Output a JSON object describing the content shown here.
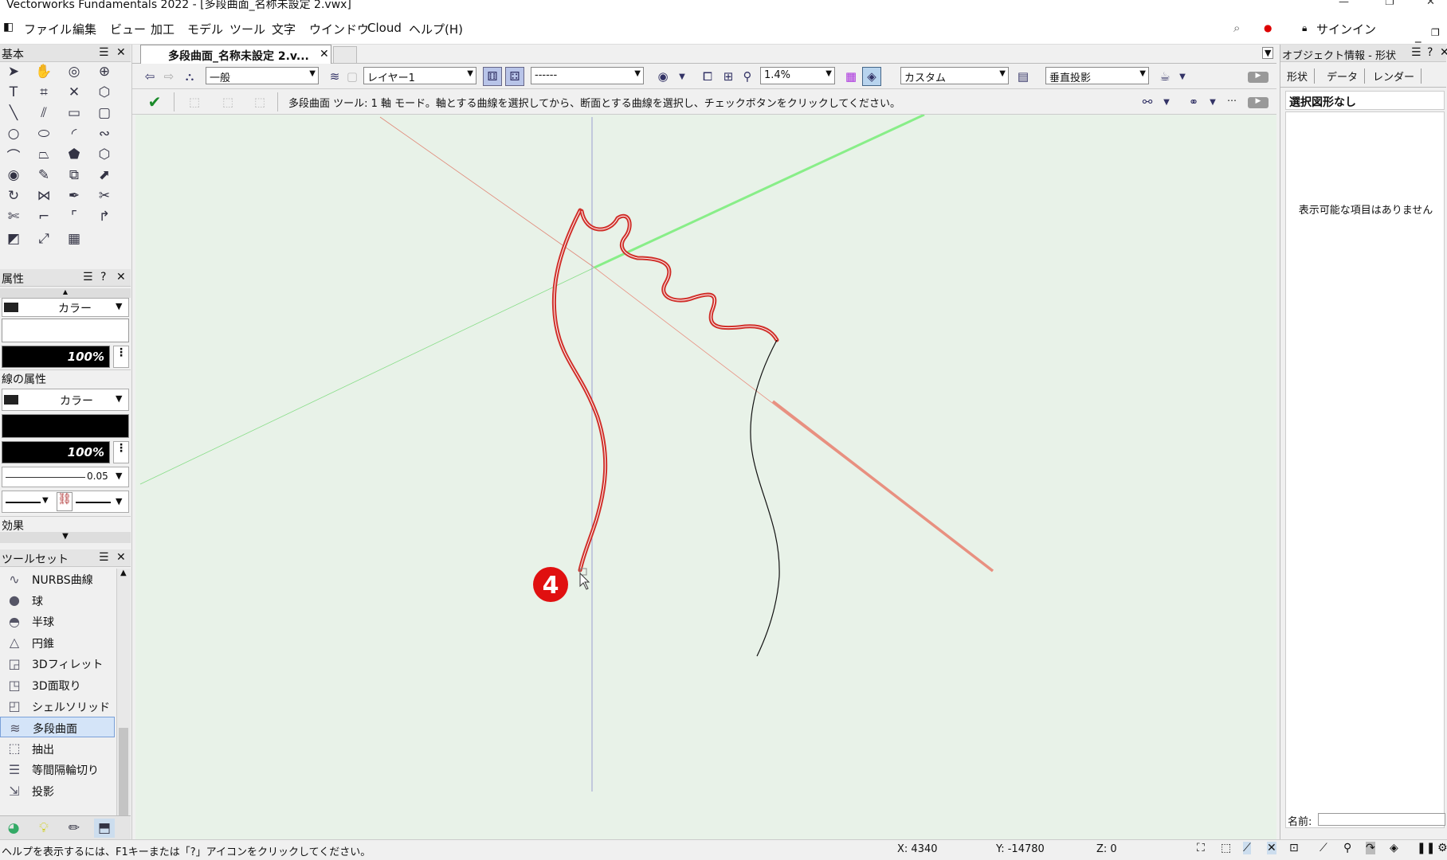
{
  "window": {
    "title": "Vectorworks Fundamentals 2022 - [多段曲面_名称未設定 2.vwx]"
  },
  "menu": [
    "ファイル",
    "編集",
    "ビュー",
    "加工",
    "モデル",
    "ツール",
    "文字",
    "ウインドウ",
    "Cloud",
    "ヘルプ(H)"
  ],
  "menu_right": {
    "signin": "サインイン"
  },
  "left_panel": {
    "basic_title": "基本",
    "attributes_title": "属性",
    "fill_type": "カラー",
    "fill_opacity": "100%",
    "line_attr_label": "線の属性",
    "line_type": "カラー",
    "line_opacity": "100%",
    "line_thickness": "0.05",
    "effects_label": "効果",
    "toolset_title": "ツールセット",
    "toolset_items": [
      {
        "label": "NURBS曲線",
        "icon": "nurbs-curve-icon",
        "glyph": "∿"
      },
      {
        "label": "球",
        "icon": "sphere-icon",
        "glyph": "●"
      },
      {
        "label": "半球",
        "icon": "hemisphere-icon",
        "glyph": "◓"
      },
      {
        "label": "円錐",
        "icon": "cone-icon",
        "glyph": "△"
      },
      {
        "label": "3Dフィレット",
        "icon": "fillet-3d-icon",
        "glyph": "◲"
      },
      {
        "label": "3D面取り",
        "icon": "chamfer-3d-icon",
        "glyph": "◳"
      },
      {
        "label": "シェルソリッド",
        "icon": "shell-solid-icon",
        "glyph": "◰"
      },
      {
        "label": "多段曲面",
        "icon": "loft-surface-icon",
        "glyph": "≋"
      },
      {
        "label": "抽出",
        "icon": "extract-icon",
        "glyph": "⬚"
      },
      {
        "label": "等間隔輪切り",
        "icon": "contour-slice-icon",
        "glyph": "☰"
      },
      {
        "label": "投影",
        "icon": "project-icon",
        "glyph": "⇲"
      }
    ],
    "selected_toolset_item": "多段曲面"
  },
  "document": {
    "tab_label": "多段曲面_名称未設定 2.v..."
  },
  "view_bar": {
    "class": "一般",
    "layer": "レイヤー1",
    "sheet": "------",
    "zoom": "1.4%",
    "view": "カスタム",
    "projection": "垂直投影"
  },
  "mode_bar": {
    "instruction": "多段曲面 ツール: 1 軸 モード。軸とする曲線を選択してから、断面とする曲線を選択し、チェックボタンをクリックしてください。"
  },
  "canvas": {
    "step_marker": "4"
  },
  "object_info": {
    "title": "オブジェクト情報 - 形状",
    "tabs": [
      "形状",
      "データ",
      "レンダー"
    ],
    "selection": "選択図形なし",
    "empty_message": "表示可能な項目はありません",
    "name_label": "名前:"
  },
  "status": {
    "help_text": "ヘルプを表示するには、F1キーまたは「?」アイコンをクリックしてください。",
    "x": "X: 4340",
    "y": "Y: -14780",
    "z": "Z: 0"
  },
  "colors": {
    "canvas_bg": "#e8f2e8",
    "highlight_curve": "#d0302a",
    "x_axis": "#e88070",
    "y_axis": "#80e080",
    "z_axis": "#8080d0",
    "marker": "#e01010"
  }
}
